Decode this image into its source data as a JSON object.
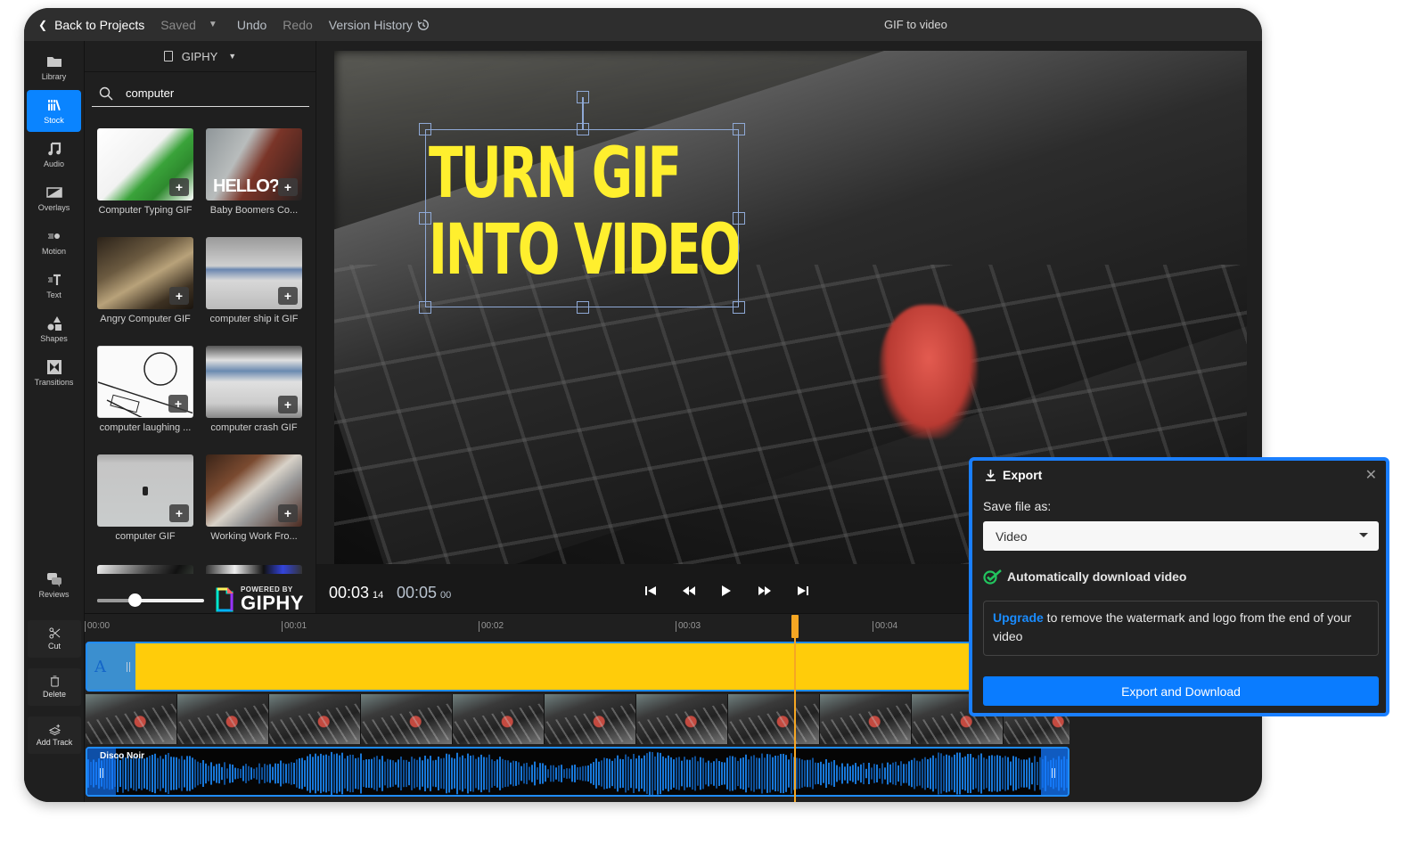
{
  "topbar": {
    "back_label": "Back to Projects",
    "saved_label": "Saved",
    "undo_label": "Undo",
    "redo_label": "Redo",
    "version_history_label": "Version History",
    "project_title": "GIF to video"
  },
  "rail": {
    "items": [
      {
        "label": "Library",
        "icon": "folder-icon"
      },
      {
        "label": "Stock",
        "icon": "books-icon",
        "active": true
      },
      {
        "label": "Audio",
        "icon": "music-note-icon"
      },
      {
        "label": "Overlays",
        "icon": "overlay-icon"
      },
      {
        "label": "Motion",
        "icon": "motion-icon"
      },
      {
        "label": "Text",
        "icon": "text-icon"
      },
      {
        "label": "Shapes",
        "icon": "shapes-icon"
      },
      {
        "label": "Transitions",
        "icon": "transitions-icon"
      },
      {
        "label": "Reviews",
        "icon": "chat-bubbles-icon"
      }
    ]
  },
  "stock": {
    "source": "GIPHY",
    "search_value": "computer",
    "results": [
      {
        "caption": "Computer Typing GIF"
      },
      {
        "caption": "Baby Boomers Co..."
      },
      {
        "caption": "Angry Computer GIF"
      },
      {
        "caption": "computer ship it GIF"
      },
      {
        "caption": "computer laughing ..."
      },
      {
        "caption": "computer crash GIF"
      },
      {
        "caption": "computer GIF"
      },
      {
        "caption": "Working Work Fro..."
      }
    ],
    "thumbnail_size_fraction": 0.35,
    "powered_by": "POWERED BY",
    "giphy_label": "GIPHY"
  },
  "preview": {
    "overlay_line1": "TURN GIF",
    "overlay_line2": "INTO VIDEO",
    "overlay_color": "#ffef2e"
  },
  "playback": {
    "current_time": "00:03",
    "current_frame": "14",
    "total_time": "00:05",
    "total_frame": "00"
  },
  "timeline": {
    "tools": [
      {
        "label": "Cut",
        "icon": "scissors-icon"
      },
      {
        "label": "Delete",
        "icon": "trash-icon"
      },
      {
        "label": "Add Track",
        "icon": "add-track-icon"
      }
    ],
    "ruler_ticks": [
      "00:00",
      "00:01",
      "00:02",
      "00:03",
      "00:04"
    ],
    "text_track_letter": "A",
    "audio_track_name": "Disco Noir",
    "playhead_seconds": 3.6,
    "accent_color": "#1f8cff",
    "text_track_color": "#ffcc0a",
    "playhead_color": "#f5a623"
  },
  "export_modal": {
    "title": "Export",
    "save_as_label": "Save file as:",
    "format_value": "Video",
    "auto_download_label": "Automatically download video",
    "auto_download_checked": true,
    "upgrade_link": "Upgrade",
    "upgrade_text": " to remove the watermark and logo from the end of your video",
    "button_label": "Export and Download",
    "accent_color": "#0a7cff"
  }
}
